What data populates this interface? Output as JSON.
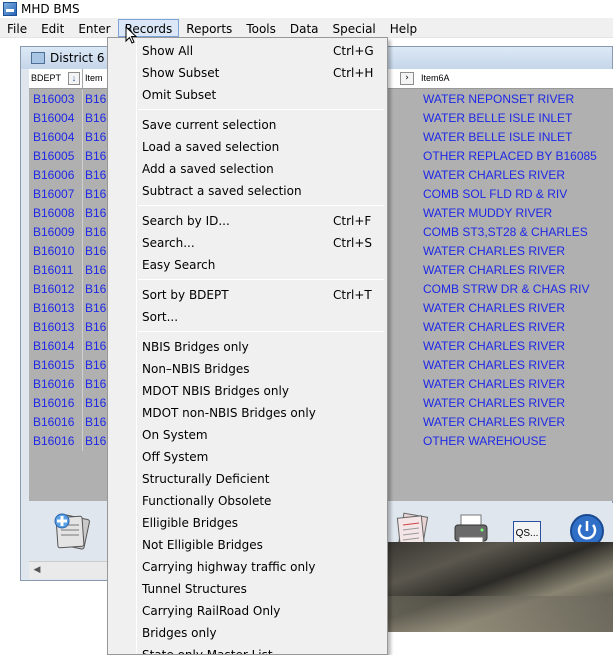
{
  "app": {
    "title": "MHD BMS"
  },
  "menubar": {
    "items": [
      "File",
      "Edit",
      "Enter",
      "Records",
      "Reports",
      "Tools",
      "Data",
      "Special",
      "Help"
    ],
    "active": "Records"
  },
  "child_window": {
    "title": "District 6 In",
    "grid": {
      "headers": {
        "bdept": "BDEPT",
        "item": "Item",
        "item6a": "Item6A"
      },
      "rows": [
        {
          "bdept": "B16003",
          "item": "B16",
          "item6a": "WATER NEPONSET RIVER"
        },
        {
          "bdept": "B16004",
          "item": "B16",
          "item6a": "WATER BELLE ISLE INLET"
        },
        {
          "bdept": "B16004",
          "item": "B16",
          "item6a": "WATER BELLE ISLE INLET"
        },
        {
          "bdept": "B16005",
          "item": "B16",
          "item6a": "OTHER REPLACED BY B16085"
        },
        {
          "bdept": "B16006",
          "item": "B16",
          "item6a": "WATER CHARLES RIVER"
        },
        {
          "bdept": "B16007",
          "item": "B16",
          "item6a": "COMB  SOL FLD RD & RIV"
        },
        {
          "bdept": "B16008",
          "item": "B16",
          "item6a": "WATER MUDDY RIVER"
        },
        {
          "bdept": "B16009",
          "item": "B16",
          "item6a": "COMB  ST3,ST28 & CHARLES"
        },
        {
          "bdept": "B16010",
          "item": "B16",
          "item6a": "WATER CHARLES RIVER"
        },
        {
          "bdept": "B16011",
          "item": "B16",
          "item6a": "WATER CHARLES RIVER"
        },
        {
          "bdept": "B16012",
          "item": "B16",
          "item6a": "COMB  STRW DR & CHAS RIV"
        },
        {
          "bdept": "B16013",
          "item": "B16",
          "item6a": "WATER CHARLES RIVER"
        },
        {
          "bdept": "B16013",
          "item": "B16",
          "item6a": "WATER CHARLES RIVER"
        },
        {
          "bdept": "B16014",
          "item": "B16",
          "item6a": "WATER CHARLES RIVER"
        },
        {
          "bdept": "B16015",
          "item": "B16",
          "item6a": "WATER CHARLES RIVER"
        },
        {
          "bdept": "B16016",
          "item": "B16",
          "item6a": "WATER CHARLES RIVER"
        },
        {
          "bdept": "B16016",
          "item": "B16",
          "item6a": "WATER CHARLES RIVER"
        },
        {
          "bdept": "B16016",
          "item": "B16",
          "item6a": "WATER CHARLES RIVER"
        },
        {
          "bdept": "B16016",
          "item": "B16",
          "item6a": "OTHER WAREHOUSE"
        }
      ]
    },
    "toolbar": {
      "qs_label": "QS..."
    }
  },
  "records_menu": {
    "groups": [
      [
        {
          "label": "Show All",
          "shortcut": "Ctrl+G"
        },
        {
          "label": "Show Subset",
          "shortcut": "Ctrl+H"
        },
        {
          "label": "Omit Subset",
          "shortcut": ""
        }
      ],
      [
        {
          "label": "Save current selection",
          "shortcut": ""
        },
        {
          "label": "Load a saved selection",
          "shortcut": ""
        },
        {
          "label": "Add a saved selection",
          "shortcut": ""
        },
        {
          "label": "Subtract a saved selection",
          "shortcut": ""
        }
      ],
      [
        {
          "label": "Search by ID...",
          "shortcut": "Ctrl+F"
        },
        {
          "label": "Search...",
          "shortcut": "Ctrl+S"
        },
        {
          "label": "Easy Search",
          "shortcut": ""
        }
      ],
      [
        {
          "label": "Sort by BDEPT",
          "shortcut": "Ctrl+T"
        },
        {
          "label": "Sort...",
          "shortcut": ""
        }
      ],
      [
        {
          "label": "NBIS Bridges only",
          "shortcut": ""
        },
        {
          "label": "Non–NBIS Bridges",
          "shortcut": ""
        },
        {
          "label": "MDOT NBIS Bridges only",
          "shortcut": ""
        },
        {
          "label": "MDOT non-NBIS Bridges only",
          "shortcut": ""
        },
        {
          "label": "On System",
          "shortcut": ""
        },
        {
          "label": "Off System",
          "shortcut": ""
        },
        {
          "label": "Structurally Deficient",
          "shortcut": ""
        },
        {
          "label": "Functionally Obsolete",
          "shortcut": ""
        },
        {
          "label": "Elligible Bridges",
          "shortcut": ""
        },
        {
          "label": "Not Elligible Bridges",
          "shortcut": ""
        },
        {
          "label": "Carrying highway traffic only",
          "shortcut": ""
        },
        {
          "label": "Tunnel Structures",
          "shortcut": ""
        },
        {
          "label": "Carrying RailRoad Only",
          "shortcut": ""
        },
        {
          "label": "Bridges only",
          "shortcut": ""
        },
        {
          "label": "State only Master List",
          "shortcut": ""
        }
      ]
    ]
  },
  "colors": {
    "link_text": "#1e28e6",
    "grid_bg": "#b0b0b0",
    "menu_bg": "#f0f0f0",
    "menu_active": "#dbe7f6"
  },
  "icons": [
    "app-icon",
    "sort-arrow-icon",
    "record-cards-icon",
    "report-icon",
    "printer-icon",
    "power-icon",
    "mouse-cursor-icon"
  ]
}
